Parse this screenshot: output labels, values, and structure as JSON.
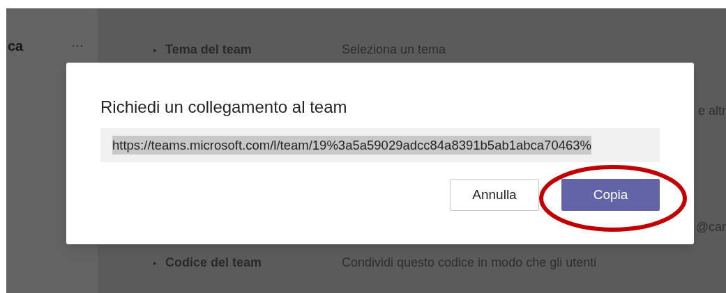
{
  "sidebar": {
    "title": "ca",
    "more": "···"
  },
  "settings": [
    {
      "expander": "▸",
      "label": "Tema del team",
      "value": "Seleziona un tema"
    },
    {
      "value": "e altr"
    },
    {
      "value": "@car"
    },
    {
      "expander": "▸",
      "label": "Codice del team",
      "value": "Condividi questo codice in modo che gli utenti"
    }
  ],
  "dialog": {
    "title": "Richiedi un collegamento al team",
    "link": "https://teams.microsoft.com/l/team/19%3a5a59029adcc84a8391b5ab1abca70463%",
    "link_selected": true,
    "buttons": [
      {
        "label": "Annulla",
        "kind": "secondary"
      },
      {
        "label": "Copia",
        "kind": "primary",
        "circled": true
      }
    ]
  }
}
